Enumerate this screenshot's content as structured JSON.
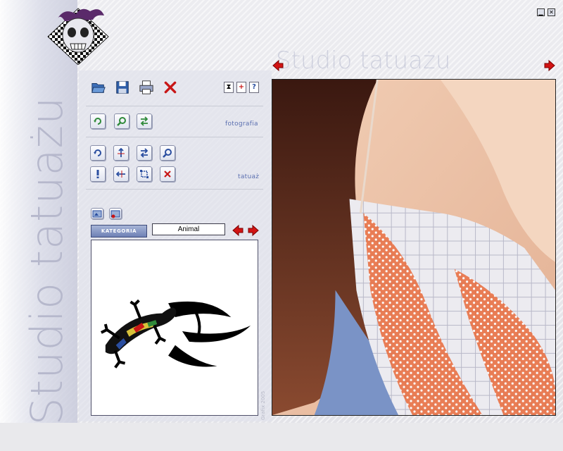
{
  "brand": {
    "vertical_text": "Studio tatuażu",
    "watermark_text": "Studio tatuażu"
  },
  "window": {
    "minimize_glyph": "▁",
    "close_glyph": "✕"
  },
  "toolbar": {
    "file_icons": [
      "open-folder-icon",
      "save-disk-icon",
      "printer-icon",
      "delete-x-icon"
    ],
    "small_icons": [
      "hourglass-icon",
      "plus-icon",
      "help-icon"
    ],
    "small_glyphs": [
      "⧗",
      "+",
      "?"
    ]
  },
  "sections": {
    "photo_label": "fotografia",
    "tattoo_label": "tatuaż"
  },
  "category": {
    "button_label": "KATEGORIA",
    "value": "Animal"
  },
  "preview": {
    "copyright": "Grafix 2005"
  },
  "colors": {
    "accent_blue": "#5b6fb0",
    "arrow_red": "#d21414",
    "icon_green": "#2f8a3a"
  }
}
